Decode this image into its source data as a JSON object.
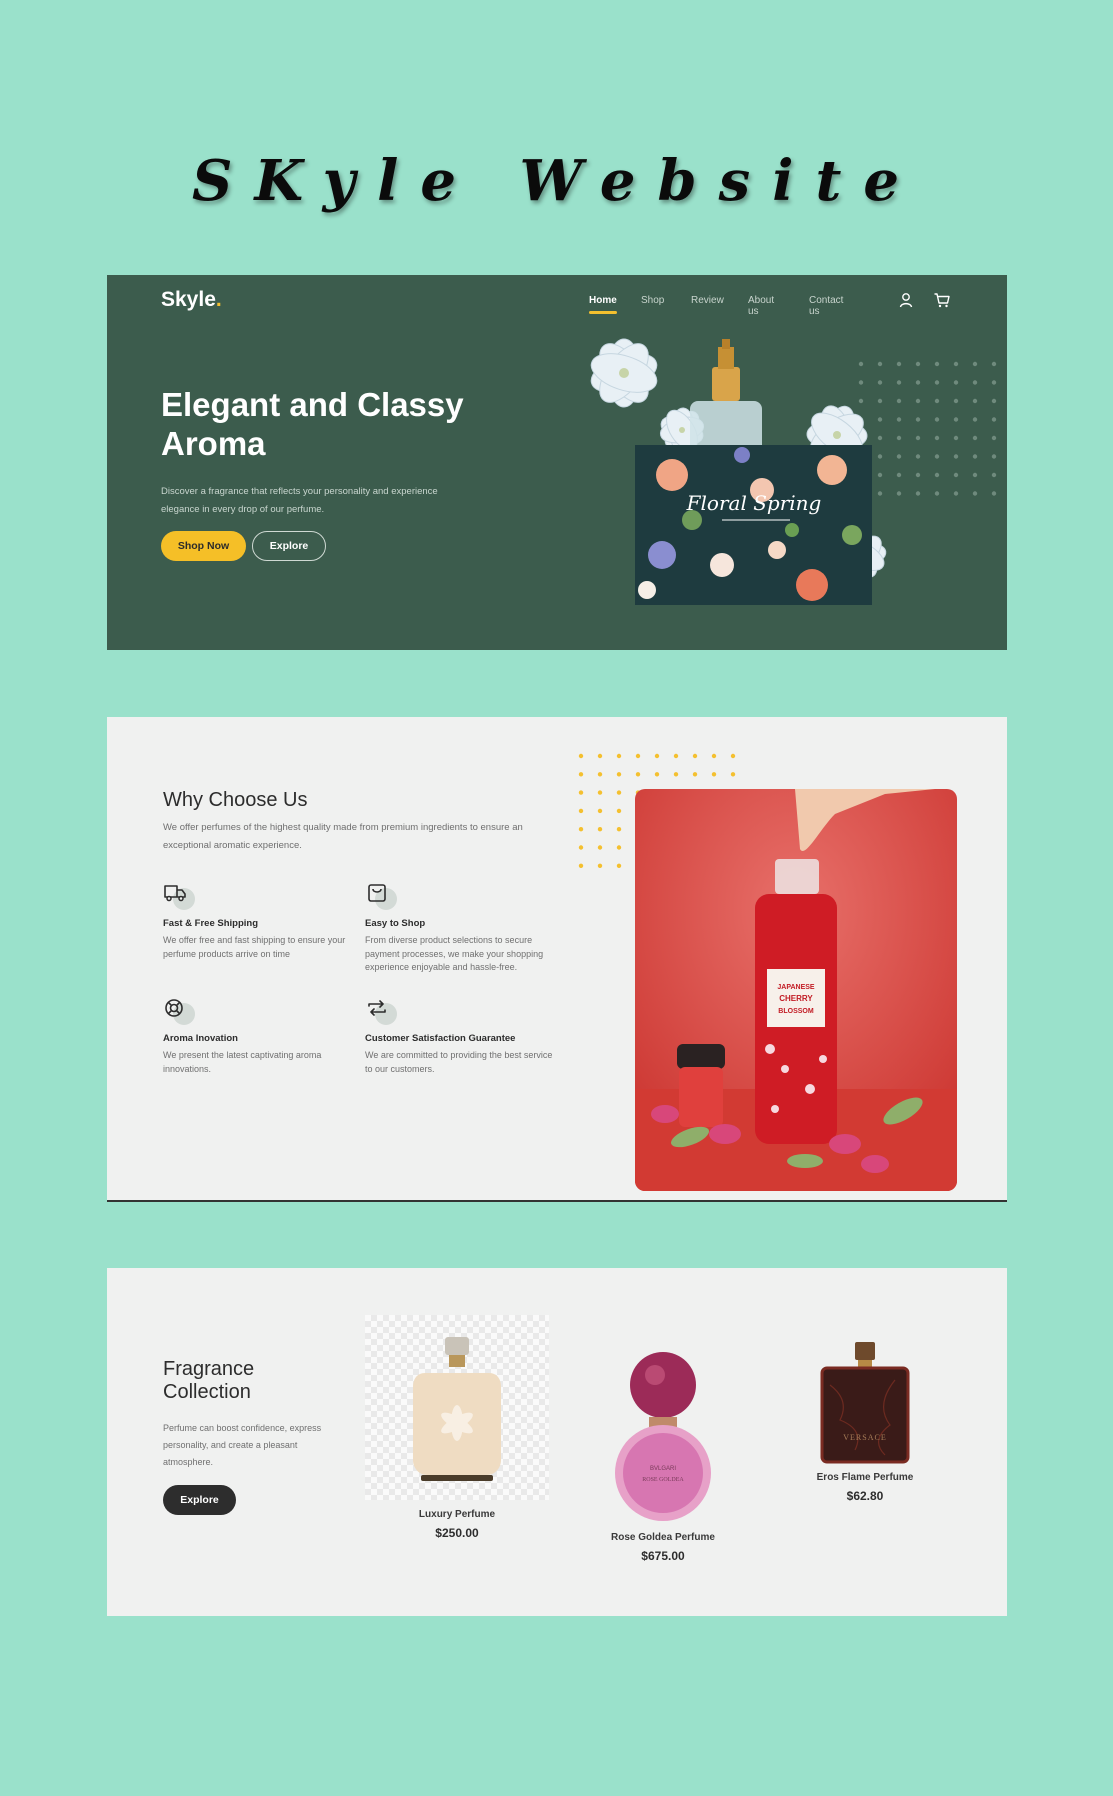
{
  "page_title": "SKyle Website",
  "colors": {
    "page_bg": "#9ae1cb",
    "hero_bg": "#3c5c4d",
    "accent_yellow": "#f5bf27",
    "section_bg": "#f0f1f0",
    "dark": "#2d2d2d"
  },
  "header": {
    "logo": "Skyle",
    "logo_dot": ".",
    "nav": [
      {
        "label": "Home",
        "active": true
      },
      {
        "label": "Shop",
        "active": false
      },
      {
        "label": "Review",
        "active": false
      },
      {
        "label": "About us",
        "active": false
      },
      {
        "label": "Contact us",
        "active": false
      }
    ],
    "icons": [
      "user-icon",
      "cart-icon"
    ]
  },
  "hero": {
    "title": "Elegant and Classy Aroma",
    "description": "Discover a fragrance that reflects your personality and experience elegance in every drop of our perfume.",
    "primary_button": "Shop Now",
    "secondary_button": "Explore",
    "box_label": "Floral Spring"
  },
  "why": {
    "title": "Why Choose Us",
    "description": "We offer perfumes of the highest quality made from premium ingredients to ensure an exceptional aromatic experience.",
    "features": [
      {
        "icon": "truck-icon",
        "title": "Fast & Free Shipping",
        "text": "We offer free and fast shipping to ensure your perfume products arrive on time"
      },
      {
        "icon": "shopping-bag-icon",
        "title": "Easy to Shop",
        "text": "From diverse product selections to secure payment processes, we make your shopping experience enjoyable and hassle-free."
      },
      {
        "icon": "lifebuoy-icon",
        "title": "Aroma Inovation",
        "text": "We present the latest captivating aroma innovations."
      },
      {
        "icon": "repeat-icon",
        "title": "Customer Satisfaction Guarantee",
        "text": "We are committed to providing the best service to our customers."
      }
    ],
    "photo_label": "JAPANESE CHERRY BLOSSOM"
  },
  "collection": {
    "title": "Fragrance Collection",
    "description": "Perfume can boost confidence, express personality, and create a pleasant atmosphere.",
    "button": "Explore",
    "products": [
      {
        "name": "Luxury Perfume",
        "price": "$250.00"
      },
      {
        "name": "Rose Goldea Perfume",
        "price": "$675.00"
      },
      {
        "name": "Eros Flame Perfume",
        "price": "$62.80"
      }
    ]
  }
}
